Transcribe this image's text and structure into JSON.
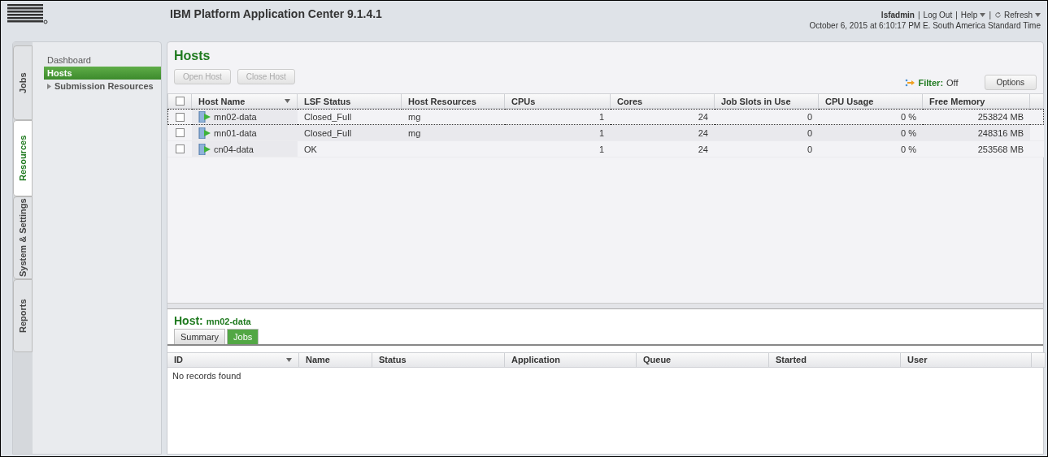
{
  "header": {
    "title": "IBM Platform Application Center 9.1.4.1",
    "user": "lsfadmin",
    "separator": "|",
    "links": [
      {
        "label": "Log Out",
        "kind": "link"
      },
      {
        "label": "Help",
        "kind": "menu"
      },
      {
        "label": "Refresh",
        "kind": "refresh"
      }
    ],
    "datetime": "October 6, 2015 at 6:10:17 PM E. South America Standard Time"
  },
  "side_tabs": [
    {
      "label": "Jobs",
      "selected": false
    },
    {
      "label": "Resources",
      "selected": true
    },
    {
      "label": "System & Settings",
      "selected": false
    },
    {
      "label": "Reports",
      "selected": false
    }
  ],
  "sidebar": {
    "items": [
      {
        "label": "Dashboard",
        "selected": false,
        "expandable": false
      },
      {
        "label": "Hosts",
        "selected": true,
        "expandable": false
      },
      {
        "label": "Submission Resources",
        "selected": false,
        "expandable": true
      }
    ]
  },
  "hosts": {
    "title": "Hosts",
    "buttons": [
      {
        "label": "Open Host",
        "disabled": true
      },
      {
        "label": "Close Host",
        "disabled": true
      }
    ],
    "filter": {
      "label": "Filter:",
      "value": "Off"
    },
    "options": "Options",
    "select_all_checked": false,
    "columns": [
      "Host Name",
      "LSF Status",
      "Host Resources",
      "CPUs",
      "Cores",
      "Job Slots in Use",
      "CPU Usage",
      "Free Memory"
    ],
    "rows": [
      {
        "selected": true,
        "checked": false,
        "cells": [
          "mn02-data",
          "Closed_Full",
          "mg",
          "1",
          "24",
          "0",
          "0 %",
          "253824 MB"
        ]
      },
      {
        "selected": false,
        "checked": false,
        "cells": [
          "mn01-data",
          "Closed_Full",
          "mg",
          "1",
          "24",
          "0",
          "0 %",
          "248316 MB"
        ]
      },
      {
        "selected": false,
        "checked": false,
        "cells": [
          "cn04-data",
          "OK",
          "",
          "1",
          "24",
          "0",
          "0 %",
          "253568 MB"
        ]
      }
    ]
  },
  "detail": {
    "label": "Host:",
    "host": "mn02-data",
    "tabs": [
      {
        "label": "Summary",
        "selected": false
      },
      {
        "label": "Jobs",
        "selected": true
      }
    ],
    "columns": [
      "ID",
      "Name",
      "Status",
      "Application",
      "Queue",
      "Started",
      "User"
    ],
    "empty": "No records found"
  }
}
